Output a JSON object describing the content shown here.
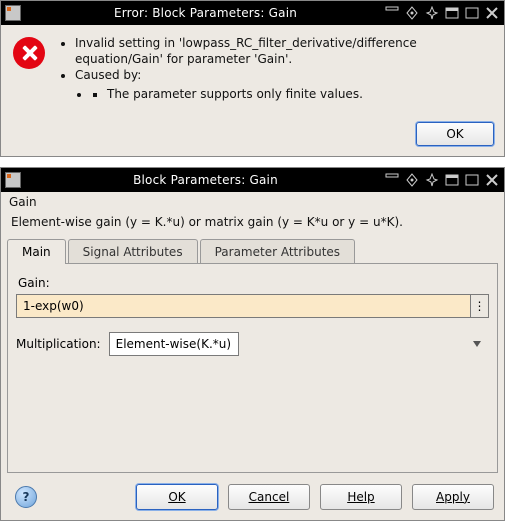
{
  "errorDialog": {
    "title": "Error: Block Parameters: Gain",
    "messageLine1": "Invalid setting in 'lowpass_RC_filter_derivative/difference equation/Gain' for parameter 'Gain'.",
    "causedBy": "Caused by:",
    "causeDetail": "The parameter supports only finite values.",
    "okLabel": "OK"
  },
  "blockParams": {
    "title": "Block Parameters: Gain",
    "blockName": "Gain",
    "description": "Element-wise gain (y = K.*u) or matrix gain (y = K*u or y = u*K).",
    "tabs": {
      "main": "Main",
      "signal": "Signal Attributes",
      "param": "Parameter Attributes"
    },
    "gainLabel": "Gain:",
    "gainValue": "1-exp(w0)",
    "moreGlyph": "⋮",
    "multLabel": "Multiplication:",
    "multValue": "Element-wise(K.*u)",
    "buttons": {
      "ok": "OK",
      "cancel": "Cancel",
      "help": "Help",
      "apply": "Apply"
    },
    "helpGlyph": "?"
  }
}
